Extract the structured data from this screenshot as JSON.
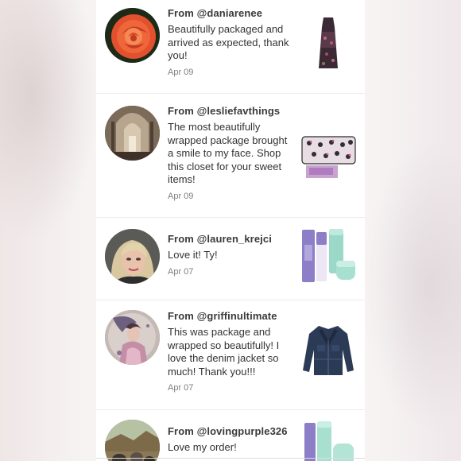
{
  "feed": {
    "items": [
      {
        "from_label": "From",
        "username": "@daniarenee",
        "message": "Beautifully packaged and arrived as expected, thank you!",
        "date": "Apr 09",
        "avatar_icon": "rose-photo",
        "thumb_icon": "maxi-dress-photo"
      },
      {
        "from_label": "From",
        "username": "@lesliefavthings",
        "message": "The most beautifully wrapped package brought a smile to my face. Shop this closet for your sweet items!",
        "date": "Apr 09",
        "avatar_icon": "cathedral-photo",
        "thumb_icon": "hello-kitty-wallet-photo"
      },
      {
        "from_label": "From",
        "username": "@lauren_krejci",
        "message": "Love it! Ty!",
        "date": "Apr 07",
        "avatar_icon": "selfie-photo",
        "thumb_icon": "skincare-set-photo"
      },
      {
        "from_label": "From",
        "username": "@griffinultimate",
        "message": "This was package and wrapped so beautifully! I love the denim jacket so much! Thank you!!!",
        "date": "Apr 07",
        "avatar_icon": "fantasy-art-photo",
        "thumb_icon": "denim-jacket-photo"
      },
      {
        "from_label": "From",
        "username": "@lovingpurple326",
        "message": "Love my order!",
        "date": "",
        "avatar_icon": "cats-photo",
        "thumb_icon": "skincare-set-photo"
      }
    ]
  },
  "colors": {
    "panel": "#ffffff",
    "background": "#f4efef",
    "text": "#333333",
    "date": "#7d7d7d"
  }
}
